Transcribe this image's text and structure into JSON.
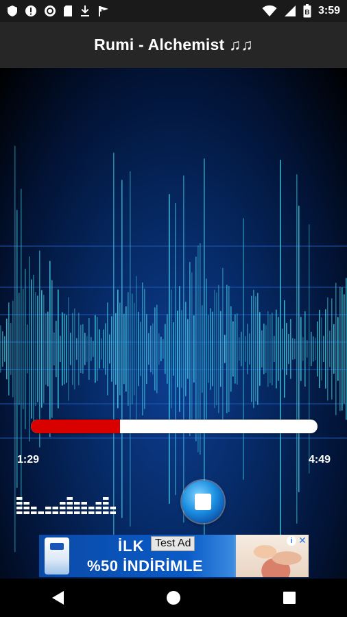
{
  "status_bar": {
    "time": "3:59",
    "icons": [
      "shield-icon",
      "alert-icon",
      "record-icon",
      "sd-card-icon",
      "download-icon",
      "flag-icon",
      "wifi-icon",
      "signal-icon",
      "battery-icon"
    ],
    "battery_level": "B"
  },
  "app_bar": {
    "title": "Rumi - Alchemist ♫♫"
  },
  "player": {
    "elapsed": "1:29",
    "total": "4:49",
    "progress": 0.31,
    "stop_icon": "stop-icon",
    "equalizer_icon": "equalizer-icon"
  },
  "ad": {
    "line1": "İLK",
    "line2": "%50 İNDİRİMLE",
    "label": "Test Ad",
    "info_icon": "info-icon",
    "close_icon": "close-icon"
  },
  "navigation": {
    "icons": [
      "back-icon",
      "home-icon",
      "recents-icon"
    ]
  },
  "colors": {
    "progress_fill": "#d90000",
    "progress_track": "#ffffff",
    "app_bar": "#262626",
    "wave": "#3fd0e6",
    "background_blue": "#0d3d8f"
  }
}
